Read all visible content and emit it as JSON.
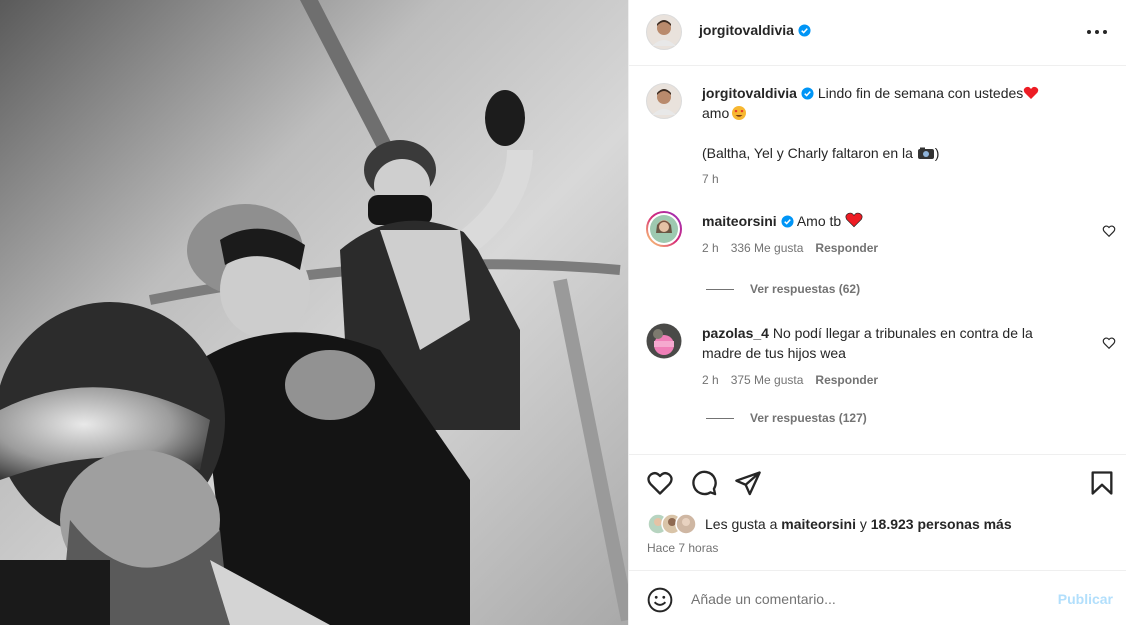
{
  "post": {
    "author": "jorgitovaldivia",
    "photo_alt": "photo",
    "caption_line1": "Lindo fin de semana con ustedes",
    "caption_line2": "amo",
    "caption_line3": "(Baltha, Yel y Charly faltaron en la",
    "caption_line3_end": ")",
    "caption_age": "7 h"
  },
  "comments": [
    {
      "user": "maiteorsini",
      "text": "Amo tb",
      "age": "2 h",
      "likes": "336 Me gusta",
      "reply": "Responder",
      "view_replies": "Ver respuestas (62)"
    },
    {
      "user": "pazolas_4",
      "text_line1": "No podí llegar a tribunales en contra de la",
      "text_line2": "madre de tus hijos wea",
      "age": "2 h",
      "likes": "375 Me gusta",
      "reply": "Responder",
      "view_replies": "Ver respuestas (127)"
    }
  ],
  "likes": {
    "prefix": "Les gusta a",
    "user": "maiteorsini",
    "joiner": "y",
    "count": "18.923 personas más"
  },
  "posted_ago": "Hace 7 horas",
  "add_comment": {
    "placeholder": "Añade un comentario...",
    "publish": "Publicar"
  },
  "colors": {
    "verified": "#0095f6",
    "heart_red": "#ed1c24",
    "publish_disabled": "#b2dffc",
    "muted": "#737373"
  },
  "icons": [
    "more-icon",
    "heart-icon",
    "comment-icon",
    "share-icon",
    "bookmark-icon",
    "emoji-icon",
    "verified-icon"
  ]
}
